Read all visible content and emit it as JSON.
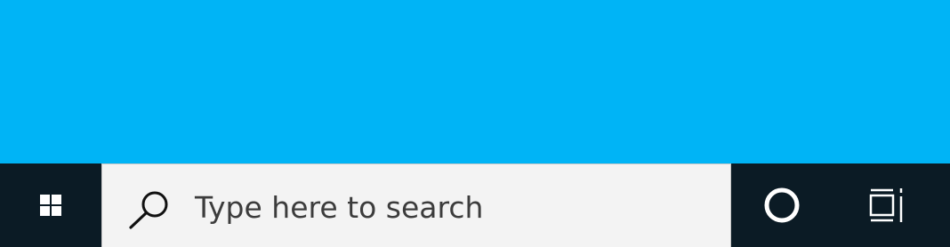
{
  "desktop": {
    "background_color": "#00b4f6"
  },
  "taskbar": {
    "background_color": "#0b1b25",
    "start": {
      "icon": "windows-logo-icon"
    },
    "search": {
      "icon": "search-icon",
      "placeholder": "Type here to search"
    },
    "cortana": {
      "icon": "cortana-circle-icon"
    },
    "task_view": {
      "icon": "task-view-icon"
    }
  }
}
